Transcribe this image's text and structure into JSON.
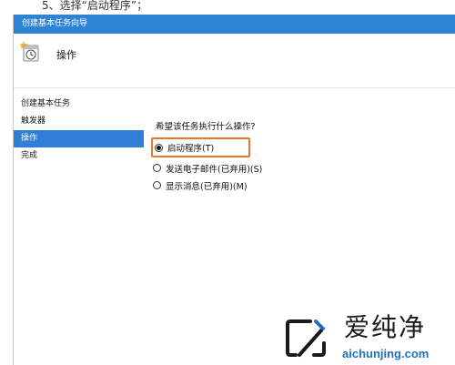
{
  "caption": "5、选择“启动程序”；",
  "window": {
    "title": "创建基本任务向导",
    "header_title": "操作"
  },
  "sidebar": {
    "items": [
      {
        "label": "创建基本任务",
        "active": false
      },
      {
        "label": "触发器",
        "active": false
      },
      {
        "label": "操作",
        "active": true
      },
      {
        "label": "完成",
        "active": false
      }
    ]
  },
  "content": {
    "question": "希望该任务执行什么操作?",
    "options": [
      {
        "label": "启动程序(T)",
        "selected": true
      },
      {
        "label": "发送电子邮件(已弃用)(S)",
        "selected": false
      },
      {
        "label": "显示消息(已弃用)(M)",
        "selected": false
      }
    ]
  },
  "watermark": {
    "brand": "爱纯净",
    "url": "aichunjing.com"
  },
  "colors": {
    "titlebar": "#2f83d6",
    "sidebar_active": "#2f7fd6",
    "highlight_border": "#e8762d",
    "watermark_url": "#1f6fc0"
  }
}
